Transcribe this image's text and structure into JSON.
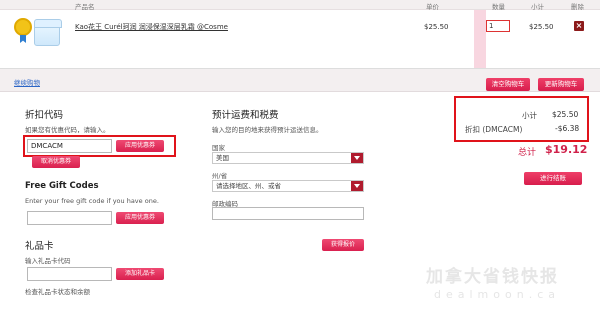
{
  "table_header": {
    "product_name": "产品名",
    "unit_price": "单价",
    "quantity": "数量",
    "subtotal": "小计",
    "delete": "删除"
  },
  "cart_item": {
    "title": "Kao花王 Curél珂润 润浸保湿深层乳霜 @Cosme",
    "price": "$25.50",
    "quantity": "1",
    "subtotal": "$25.50",
    "delete_symbol": "×"
  },
  "actions": {
    "continue_shopping": "继续购物",
    "clear_cart": "清空购物车",
    "update_cart": "更新购物车"
  },
  "discount": {
    "heading": "折扣代码",
    "hint": "如果您有优惠代码，请输入。",
    "code_value": "DMCACM",
    "apply_button": "应用优惠券",
    "cancel_button": "取消优惠券"
  },
  "gift_code": {
    "heading": "Free Gift Codes",
    "hint": "Enter your free gift code if you have one.",
    "apply_button": "应用优惠券"
  },
  "gift_card": {
    "heading": "礼品卡",
    "hint": "输入礼品卡代码",
    "add_button": "添加礼品卡",
    "check_link": "检查礼品卡状态和余额"
  },
  "shipping": {
    "heading": "预计运费和税费",
    "hint": "输入您的目的地来获得预计运送信息。",
    "country_label": "国家",
    "country_value": "美国",
    "state_label": "州/省",
    "state_placeholder": "请选择地区、州、或省",
    "zip_label": "邮政编码",
    "quote_button": "获得报价"
  },
  "summary": {
    "subtotal_label": "小计",
    "subtotal_value": "$25.50",
    "discount_label": "折扣 (DMCACM)",
    "discount_value": "-$6.38",
    "total_label": "总计",
    "total_value": "$19.12",
    "checkout_button": "进行结账"
  },
  "watermark": {
    "line1": "加拿大省钱快报",
    "line2": "dealmoon.ca"
  },
  "colors": {
    "accent": "#d71d4c",
    "highlight_box": "#e0131a",
    "link": "#2b65c6"
  }
}
